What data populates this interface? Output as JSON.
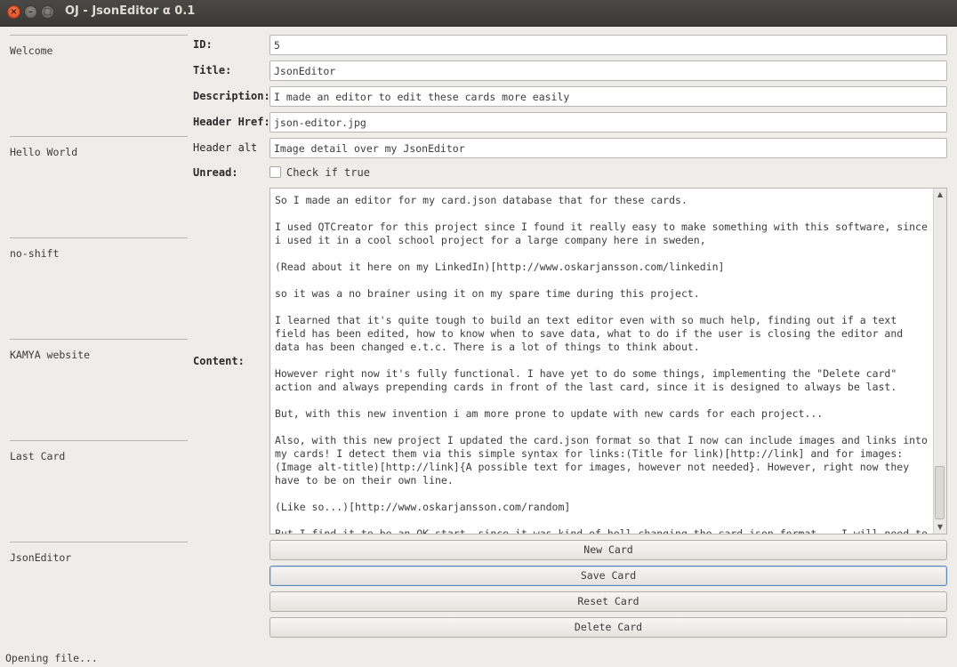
{
  "window": {
    "title": "OJ - JsonEditor α 0.1",
    "close_glyph": "×",
    "min_glyph": "–",
    "max_glyph": "□"
  },
  "sidebar": {
    "items": [
      {
        "label": "Welcome"
      },
      {
        "label": "Hello World"
      },
      {
        "label": "no-shift"
      },
      {
        "label": "KAMYA website"
      },
      {
        "label": "Last Card"
      },
      {
        "label": "JsonEditor"
      }
    ]
  },
  "form": {
    "id_label": "ID:",
    "id_value": "5",
    "title_label": "Title:",
    "title_value": "JsonEditor",
    "description_label": "Description:",
    "description_value": "I made an editor to edit these cards more easily",
    "header_href_label": "Header Href:",
    "header_href_value": "json-editor.jpg",
    "header_alt_label": "Header alt",
    "header_alt_value": "Image detail over my JsonEditor",
    "unread_label": "Unread:",
    "unread_checkbox_label": "Check if true",
    "unread_checked": false,
    "content_label": "Content:",
    "content_text": "So I made an editor for my card.json database that for these cards.\n\nI used QTCreator for this project since I found it really easy to make something with this software, since i used it in a cool school project for a large company here in sweden,\n\n(Read about it here on my LinkedIn)[http://www.oskarjansson.com/linkedin]\n\nso it was a no brainer using it on my spare time during this project.\n\nI learned that it's quite tough to build an text editor even with so much help, finding out if a text field has been edited, how to know when to save data, what to do if the user is closing the editor and data has been changed e.t.c. There is a lot of things to think about.\n\nHowever right now it's fully functional. I have yet to do some things, implementing the \"Delete card\" action and always prepending cards in front of the last card, since it is designed to always be last.\n\nBut, with this new invention i am more prone to update with new cards for each project...\n\nAlso, with this new project I updated the card.json format so that I now can include images and links into my cards! I detect them via this simple syntax for links:(Title for link)[http://link] and for images: (Image alt-title)[http://link]{A possible text for images, however not needed}. However, right now they have to be on their own line.\n\n(Like so...)[http://www.oskarjansson.com/random]\n\nBut I find it to be an OK start, since it was kind of hell changing the card.json format... I will need to"
  },
  "scrollbar": {
    "up_glyph": "▲",
    "down_glyph": "▼"
  },
  "buttons": {
    "new_card": "New Card",
    "save_card": "Save Card",
    "reset_card": "Reset Card",
    "delete_card": "Delete Card"
  },
  "status": {
    "text": "Opening file..."
  }
}
